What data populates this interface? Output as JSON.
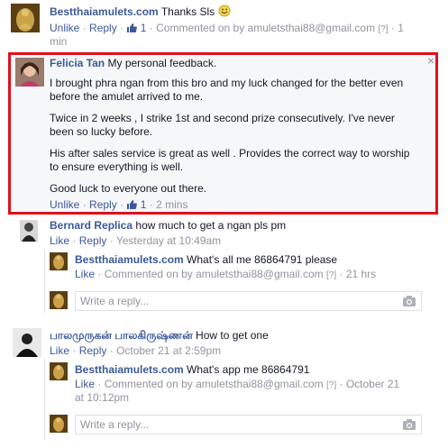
{
  "comments": [
    {
      "author": "Bestthaiamulets.com",
      "text": "Thanks Sls",
      "emoji": "smiley-icon",
      "unlike": "Unlike",
      "reply": "Reply",
      "likes": "1",
      "meta_line1": "Commented on by amuletsthai88@gmail.com",
      "hint": "[?]",
      "time_part1": "1",
      "time_part2": "min"
    },
    {
      "author": "Felicia Tan",
      "text": "My personal feedback.",
      "paragraphs": [
        [
          "I brought phra ngan from this bro and my luck changed for the better even",
          "before the amulet arrived to me."
        ],
        [
          "Twice in 2 weeks , I strike 1st and second prize consecutively. I've never",
          "been so lucky before."
        ],
        [
          "His after sales service is great as well . Provides the correct way to worship",
          "to ensure everything is well."
        ],
        [
          "Good luck to everyone out there."
        ]
      ],
      "unlike": "Unlike",
      "reply": "Reply",
      "likes": "1",
      "time": "2 mins",
      "close": "×"
    },
    {
      "author": "Bernard Replica",
      "text": "how much to get a ngan pls pm",
      "like": "Like",
      "reply": "Reply",
      "time": "Yesterday at 10:49am",
      "replies": [
        {
          "author": "Bestthaiamulets.com",
          "text": "What's all me 86864791 please",
          "like": "Like",
          "meta": "Commented on by amuletsthai88@gmail.com",
          "hint": "[?]",
          "time": "21 hrs"
        }
      ],
      "reply_placeholder": "Write a reply..."
    },
    {
      "author": "பாலமுருகன் பாலகிருஷ்ணன்",
      "text": "How to get one",
      "like": "Like",
      "reply": "Reply",
      "time": "October 21 at 2:59pm",
      "replies": [
        {
          "author": "Bestthaiamulets.com",
          "text": "What's app me 86864791",
          "like": "Like",
          "meta": "Commented on by amuletsthai88@gmail.com",
          "hint": "[?]",
          "time_part1": "October 21",
          "time_part2": "at 10:12pm"
        }
      ],
      "reply_placeholder": "Write a reply..."
    }
  ],
  "colors": {
    "link": "#3b5998",
    "meta": "#90949c",
    "highlight_border": "#e0101c"
  }
}
